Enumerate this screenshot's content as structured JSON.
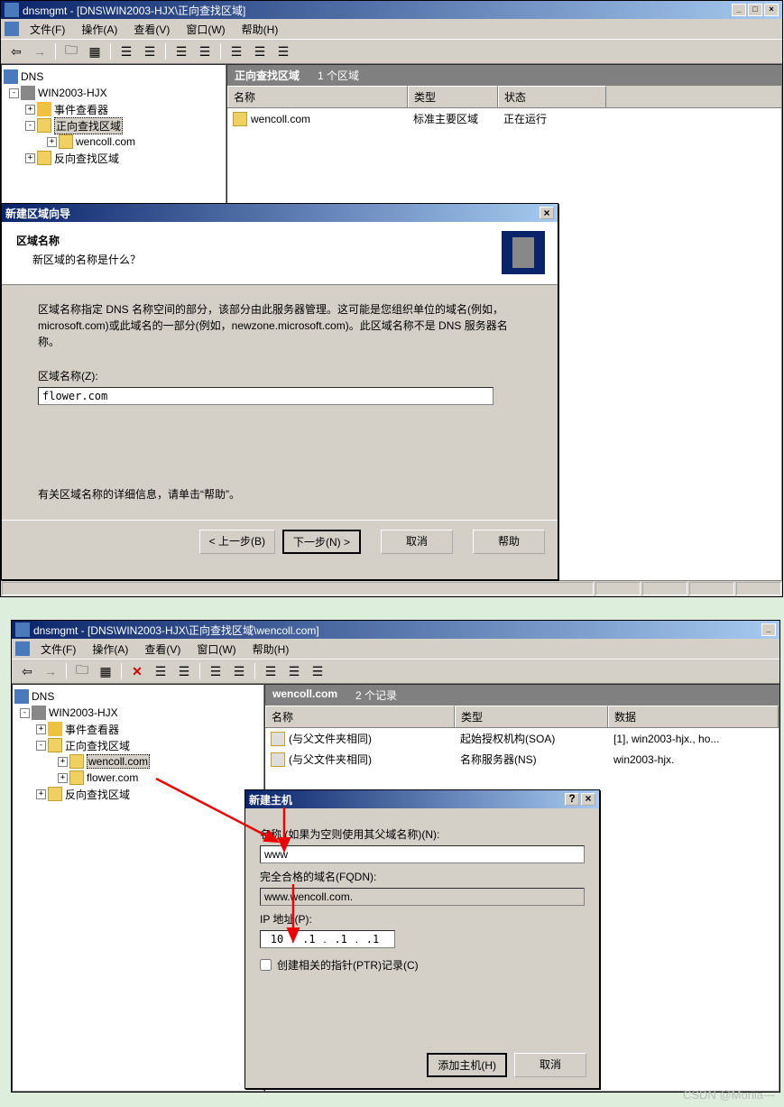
{
  "shot1": {
    "title": "dnsmgmt - [DNS\\WIN2003-HJX\\正向查找区域]",
    "menus": {
      "file": "文件(F)",
      "action": "操作(A)",
      "view": "查看(V)",
      "window": "窗口(W)",
      "help": "帮助(H)"
    },
    "tree": {
      "root": "DNS",
      "server": "WIN2003-HJX",
      "eventviewer": "事件查看器",
      "fwdzone": "正向查找区域",
      "zone1": "wencoll.com",
      "revzone": "反向查找区域"
    },
    "list": {
      "header_title": "正向查找区域",
      "header_count": "1 个区域",
      "col_name": "名称",
      "col_type": "类型",
      "col_status": "状态",
      "rows": [
        {
          "name": "wencoll.com",
          "type": "标准主要区域",
          "status": "正在运行"
        }
      ]
    },
    "wizard": {
      "title": "新建区域向导",
      "heading": "区域名称",
      "subheading": "新区域的名称是什么？",
      "desc": "区域名称指定 DNS 名称空间的部分，该部分由此服务器管理。这可能是您组织单位的域名(例如，microsoft.com)或此域名的一部分(例如，newzone.microsoft.com)。此区域名称不是 DNS 服务器名称。",
      "field_label": "区域名称(Z):",
      "field_value": "flower.com",
      "footer_hint": "有关区域名称的详细信息，请单击“帮助”。",
      "btn_prev": "< 上一步(B)",
      "btn_next": "下一步(N) >",
      "btn_cancel": "取消",
      "btn_help": "帮助"
    }
  },
  "shot2": {
    "title": "dnsmgmt - [DNS\\WIN2003-HJX\\正向查找区域\\wencoll.com]",
    "menus": {
      "file": "文件(F)",
      "action": "操作(A)",
      "view": "查看(V)",
      "window": "窗口(W)",
      "help": "帮助(H)"
    },
    "tree": {
      "root": "DNS",
      "server": "WIN2003-HJX",
      "eventviewer": "事件查看器",
      "fwdzone": "正向查找区域",
      "zone1": "wencoll.com",
      "zone2": "flower.com",
      "revzone": "反向查找区域"
    },
    "list": {
      "header_title": "wencoll.com",
      "header_count": "2 个记录",
      "col_name": "名称",
      "col_type": "类型",
      "col_data": "数据",
      "rows": [
        {
          "name": "(与父文件夹相同)",
          "type": "起始授权机构(SOA)",
          "data": "[1], win2003-hjx., ho..."
        },
        {
          "name": "(与父文件夹相同)",
          "type": "名称服务器(NS)",
          "data": "win2003-hjx."
        }
      ]
    },
    "host": {
      "title": "新建主机",
      "name_label": "名称 (如果为空则使用其父域名称)(N):",
      "name_value": "www",
      "fqdn_label": "完全合格的域名(FQDN):",
      "fqdn_value": "www.wencoll.com.",
      "ip_label": "IP 地址(P):",
      "ip": {
        "a": "10",
        "b": ".1",
        "c": ".1",
        "d": ".1"
      },
      "ptr_label": "创建相关的指针(PTR)记录(C)",
      "btn_add": "添加主机(H)",
      "btn_cancel": "取消"
    }
  },
  "watermark": "CSDN @Moriia---"
}
